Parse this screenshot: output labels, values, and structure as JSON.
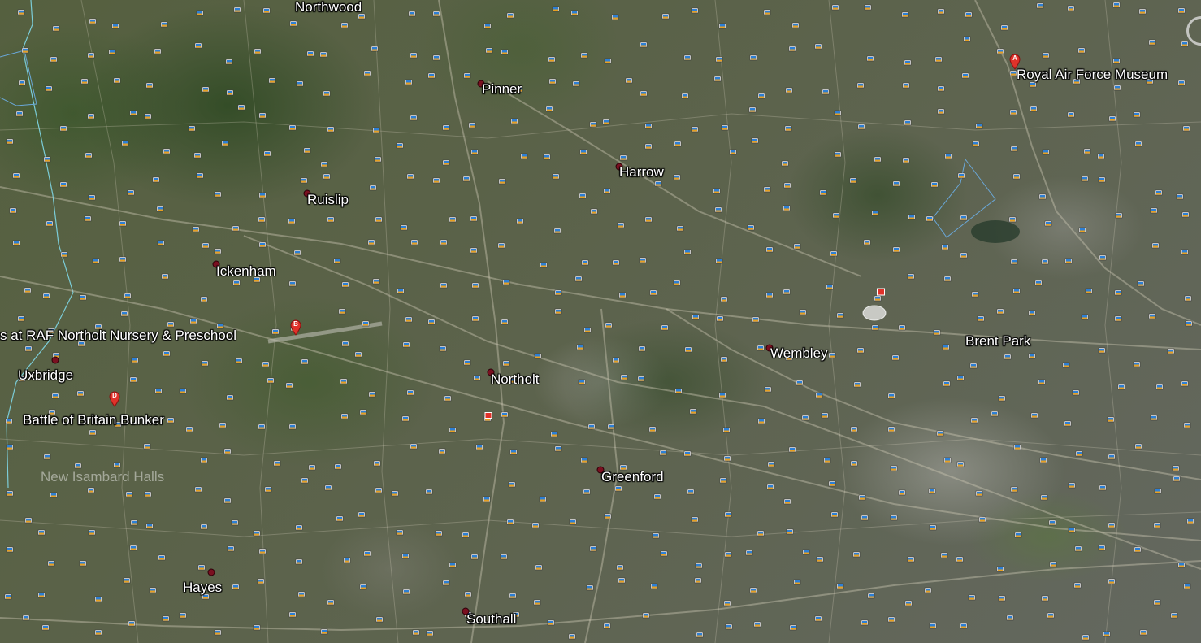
{
  "map": {
    "places": {
      "northwood": "Northwood",
      "pinner": "Pinner",
      "harrow": "Harrow",
      "ruislip": "Ruislip",
      "ickenham": "Ickenham",
      "raf_northolt": "s at RAF Northolt Nursery & Preschool",
      "uxbridge": "Uxbridge",
      "battle_bunker": "Battle of Britain Bunker",
      "new_isambard": "New Isambard Halls",
      "northolt": "Northolt",
      "wembley": "Wembley",
      "brent_park": "Brent Park",
      "greenford": "Greenford",
      "hayes": "Hayes",
      "southall": "Southall",
      "raf_museum": "Royal Air Force Museum"
    },
    "pins": {
      "a": "A",
      "b": "B",
      "d": "D"
    },
    "colors": {
      "pin_red": "#e0322a",
      "city_dot": "#7a1020",
      "boundary": "#7fd8e8",
      "photo_icon": "#2c7fd6"
    }
  }
}
